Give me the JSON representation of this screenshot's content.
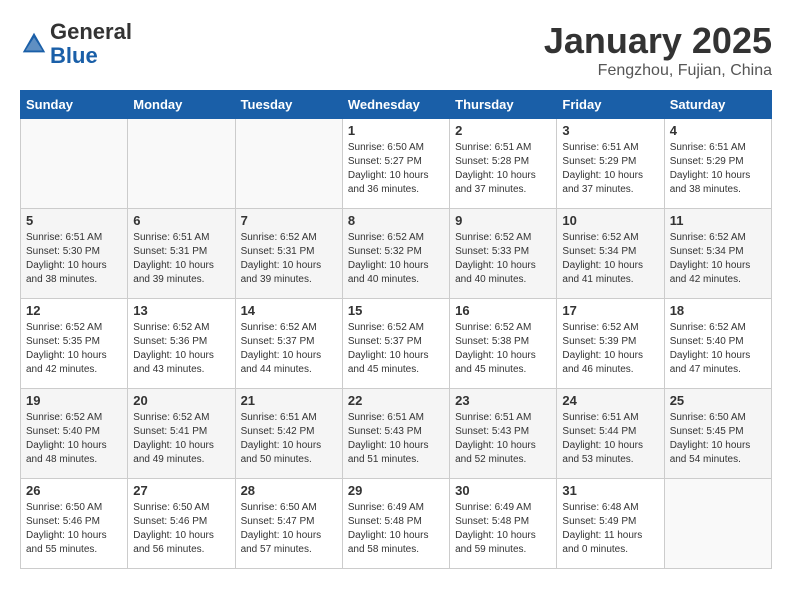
{
  "header": {
    "logo_general": "General",
    "logo_blue": "Blue",
    "title": "January 2025",
    "subtitle": "Fengzhou, Fujian, China"
  },
  "calendar": {
    "days_of_week": [
      "Sunday",
      "Monday",
      "Tuesday",
      "Wednesday",
      "Thursday",
      "Friday",
      "Saturday"
    ],
    "weeks": [
      [
        {
          "day": "",
          "info": ""
        },
        {
          "day": "",
          "info": ""
        },
        {
          "day": "",
          "info": ""
        },
        {
          "day": "1",
          "info": "Sunrise: 6:50 AM\nSunset: 5:27 PM\nDaylight: 10 hours\nand 36 minutes."
        },
        {
          "day": "2",
          "info": "Sunrise: 6:51 AM\nSunset: 5:28 PM\nDaylight: 10 hours\nand 37 minutes."
        },
        {
          "day": "3",
          "info": "Sunrise: 6:51 AM\nSunset: 5:29 PM\nDaylight: 10 hours\nand 37 minutes."
        },
        {
          "day": "4",
          "info": "Sunrise: 6:51 AM\nSunset: 5:29 PM\nDaylight: 10 hours\nand 38 minutes."
        }
      ],
      [
        {
          "day": "5",
          "info": "Sunrise: 6:51 AM\nSunset: 5:30 PM\nDaylight: 10 hours\nand 38 minutes."
        },
        {
          "day": "6",
          "info": "Sunrise: 6:51 AM\nSunset: 5:31 PM\nDaylight: 10 hours\nand 39 minutes."
        },
        {
          "day": "7",
          "info": "Sunrise: 6:52 AM\nSunset: 5:31 PM\nDaylight: 10 hours\nand 39 minutes."
        },
        {
          "day": "8",
          "info": "Sunrise: 6:52 AM\nSunset: 5:32 PM\nDaylight: 10 hours\nand 40 minutes."
        },
        {
          "day": "9",
          "info": "Sunrise: 6:52 AM\nSunset: 5:33 PM\nDaylight: 10 hours\nand 40 minutes."
        },
        {
          "day": "10",
          "info": "Sunrise: 6:52 AM\nSunset: 5:34 PM\nDaylight: 10 hours\nand 41 minutes."
        },
        {
          "day": "11",
          "info": "Sunrise: 6:52 AM\nSunset: 5:34 PM\nDaylight: 10 hours\nand 42 minutes."
        }
      ],
      [
        {
          "day": "12",
          "info": "Sunrise: 6:52 AM\nSunset: 5:35 PM\nDaylight: 10 hours\nand 42 minutes."
        },
        {
          "day": "13",
          "info": "Sunrise: 6:52 AM\nSunset: 5:36 PM\nDaylight: 10 hours\nand 43 minutes."
        },
        {
          "day": "14",
          "info": "Sunrise: 6:52 AM\nSunset: 5:37 PM\nDaylight: 10 hours\nand 44 minutes."
        },
        {
          "day": "15",
          "info": "Sunrise: 6:52 AM\nSunset: 5:37 PM\nDaylight: 10 hours\nand 45 minutes."
        },
        {
          "day": "16",
          "info": "Sunrise: 6:52 AM\nSunset: 5:38 PM\nDaylight: 10 hours\nand 45 minutes."
        },
        {
          "day": "17",
          "info": "Sunrise: 6:52 AM\nSunset: 5:39 PM\nDaylight: 10 hours\nand 46 minutes."
        },
        {
          "day": "18",
          "info": "Sunrise: 6:52 AM\nSunset: 5:40 PM\nDaylight: 10 hours\nand 47 minutes."
        }
      ],
      [
        {
          "day": "19",
          "info": "Sunrise: 6:52 AM\nSunset: 5:40 PM\nDaylight: 10 hours\nand 48 minutes."
        },
        {
          "day": "20",
          "info": "Sunrise: 6:52 AM\nSunset: 5:41 PM\nDaylight: 10 hours\nand 49 minutes."
        },
        {
          "day": "21",
          "info": "Sunrise: 6:51 AM\nSunset: 5:42 PM\nDaylight: 10 hours\nand 50 minutes."
        },
        {
          "day": "22",
          "info": "Sunrise: 6:51 AM\nSunset: 5:43 PM\nDaylight: 10 hours\nand 51 minutes."
        },
        {
          "day": "23",
          "info": "Sunrise: 6:51 AM\nSunset: 5:43 PM\nDaylight: 10 hours\nand 52 minutes."
        },
        {
          "day": "24",
          "info": "Sunrise: 6:51 AM\nSunset: 5:44 PM\nDaylight: 10 hours\nand 53 minutes."
        },
        {
          "day": "25",
          "info": "Sunrise: 6:50 AM\nSunset: 5:45 PM\nDaylight: 10 hours\nand 54 minutes."
        }
      ],
      [
        {
          "day": "26",
          "info": "Sunrise: 6:50 AM\nSunset: 5:46 PM\nDaylight: 10 hours\nand 55 minutes."
        },
        {
          "day": "27",
          "info": "Sunrise: 6:50 AM\nSunset: 5:46 PM\nDaylight: 10 hours\nand 56 minutes."
        },
        {
          "day": "28",
          "info": "Sunrise: 6:50 AM\nSunset: 5:47 PM\nDaylight: 10 hours\nand 57 minutes."
        },
        {
          "day": "29",
          "info": "Sunrise: 6:49 AM\nSunset: 5:48 PM\nDaylight: 10 hours\nand 58 minutes."
        },
        {
          "day": "30",
          "info": "Sunrise: 6:49 AM\nSunset: 5:48 PM\nDaylight: 10 hours\nand 59 minutes."
        },
        {
          "day": "31",
          "info": "Sunrise: 6:48 AM\nSunset: 5:49 PM\nDaylight: 11 hours\nand 0 minutes."
        },
        {
          "day": "",
          "info": ""
        }
      ]
    ]
  }
}
